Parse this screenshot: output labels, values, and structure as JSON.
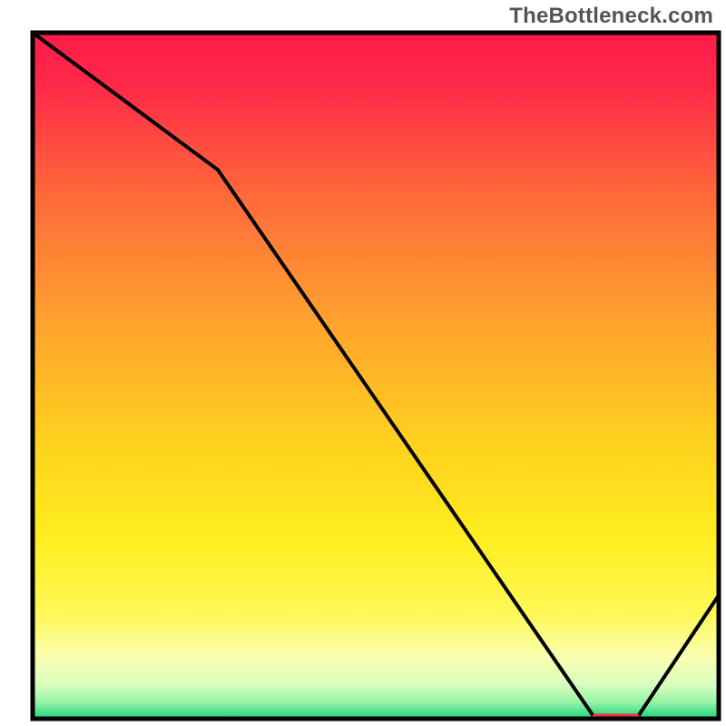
{
  "watermark": "TheBottleneck.com",
  "chart_data": {
    "type": "line",
    "title": "",
    "xlabel": "",
    "ylabel": "",
    "xlim": [
      0,
      100
    ],
    "ylim": [
      0,
      100
    ],
    "x": [
      0,
      27,
      82,
      88,
      100
    ],
    "values": [
      100,
      80,
      0,
      0,
      18
    ],
    "notes": "Single black curve on a red→yellow→green vertical gradient. No axis ticks, no legend. Thin red segment lies on the x-axis between x≈82 and x≈88 (the curve's minimum).",
    "bottom_marker": {
      "x_start": 82,
      "x_end": 88,
      "color": "#ff2a3c"
    }
  },
  "colors": {
    "frame": "#000000",
    "curve": "#000000",
    "marker": "#ff2a3c"
  }
}
